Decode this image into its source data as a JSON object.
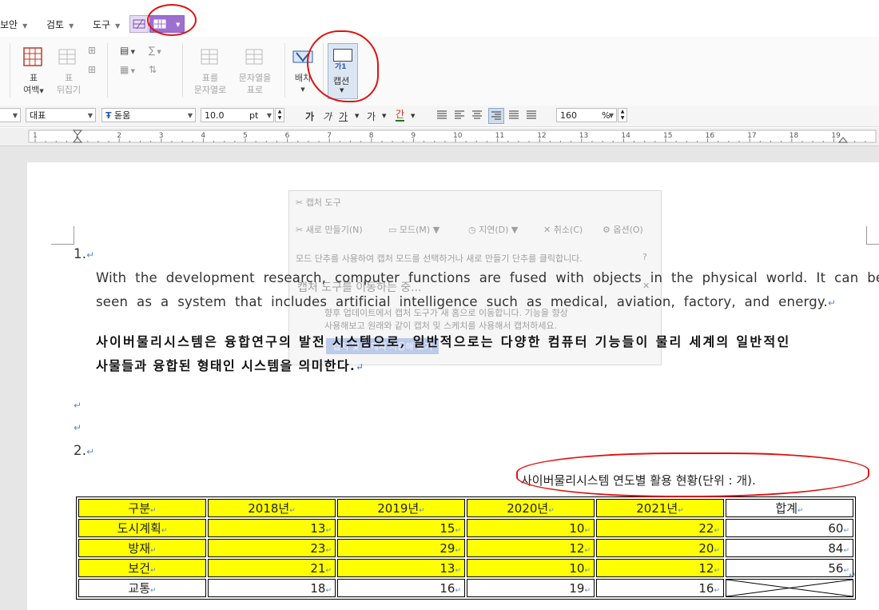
{
  "menubar": {
    "items": [
      {
        "label": "보안"
      },
      {
        "label": "검토"
      },
      {
        "label": "도구"
      }
    ]
  },
  "ribbon": {
    "margin_btn": {
      "line1": "표",
      "line2": "여백"
    },
    "flip_btn": {
      "line1": "표",
      "line2": "뒤집기"
    },
    "table_to_text": {
      "line1": "표를",
      "line2": "문자열로"
    },
    "text_to_table": {
      "line1": "문자열을",
      "line2": "표로"
    },
    "arrange": {
      "line1": "배치"
    },
    "caption": {
      "icon_text": "가1",
      "line1": "캡션"
    }
  },
  "formatbar": {
    "style": "대표",
    "font": "돋움",
    "font_icon": "Ŧ",
    "size": "10.0",
    "unit": "pt",
    "bold_glyph": "가",
    "italic_glyph": "가",
    "underline_glyph": "가",
    "strike_glyph": "가",
    "color_glyph": "간",
    "zoom": "160",
    "zoom_unit": "%"
  },
  "ruler": {
    "numbers": [
      "1",
      "1",
      "2",
      "3",
      "4",
      "5",
      "6",
      "7",
      "8",
      "9",
      "10",
      "11",
      "12",
      "13",
      "14",
      "15",
      "16",
      "17",
      "18",
      "19"
    ]
  },
  "capture_tool": {
    "title": "캡처 도구",
    "new": "새로 만들기(N)",
    "mode": "모드(M)",
    "delay": "지연(D)",
    "cancel": "취소(C)",
    "options": "옵션(O)",
    "hint": "모드 단추를 사용하여 캡처 모드를 선택하거나 새로 만들기 단추를 클릭합니다.",
    "notice_title": "캡처 도구를 이동하는 중...",
    "notice_line1": "향후 업데이트에서 캡처 도구가 새 홈으로 이동합니다. 기능을 향상",
    "notice_line2": "사용해보고 원래와 같이 캡처 및 스케치를 사용해서 캡처하세요.",
    "notice_btn": "캡처 및 스케치 사용해 보기"
  },
  "document": {
    "item1_number": "1.",
    "para_en_line1": "With  the  development  research,  computer  functions  are  fused  with  objects  in  the  physical  world.  It  can  be",
    "para_en_line2": "seen  as  a  system  that  includes  artificial  intelligence  such  as  medical,  aviation,  factory,  and  energy.",
    "para_ko_line1": "사이버물리시스템은 융합연구의 발전 시스템으로, 일반적으로는 다양한 컴퓨터 기능들이 물리 세계의 일반적인",
    "para_ko_line2": "사물들과 융합된 형태인 시스템을 의미한다.",
    "item2_number": "2.",
    "paragraph_mark": "↵",
    "caption": "사이버물리시스템 연도별 활용 현황(단위 : 개)."
  },
  "table": {
    "headers": [
      "구분",
      "2018년",
      "2019년",
      "2020년",
      "2021년",
      "합계"
    ],
    "rows": [
      {
        "label": "도시계획",
        "values": [
          "13",
          "15",
          "10",
          "22"
        ],
        "total": "60"
      },
      {
        "label": "방재",
        "values": [
          "23",
          "29",
          "12",
          "20"
        ],
        "total": "84"
      },
      {
        "label": "보건",
        "values": [
          "21",
          "13",
          "10",
          "12"
        ],
        "total": "56"
      },
      {
        "label": "교통",
        "values": [
          "18",
          "16",
          "19",
          "16"
        ],
        "total": ""
      }
    ]
  },
  "colors": {
    "highlight": "#ffff00",
    "annotation": "#e01010",
    "accent": "#9c6fd1"
  }
}
